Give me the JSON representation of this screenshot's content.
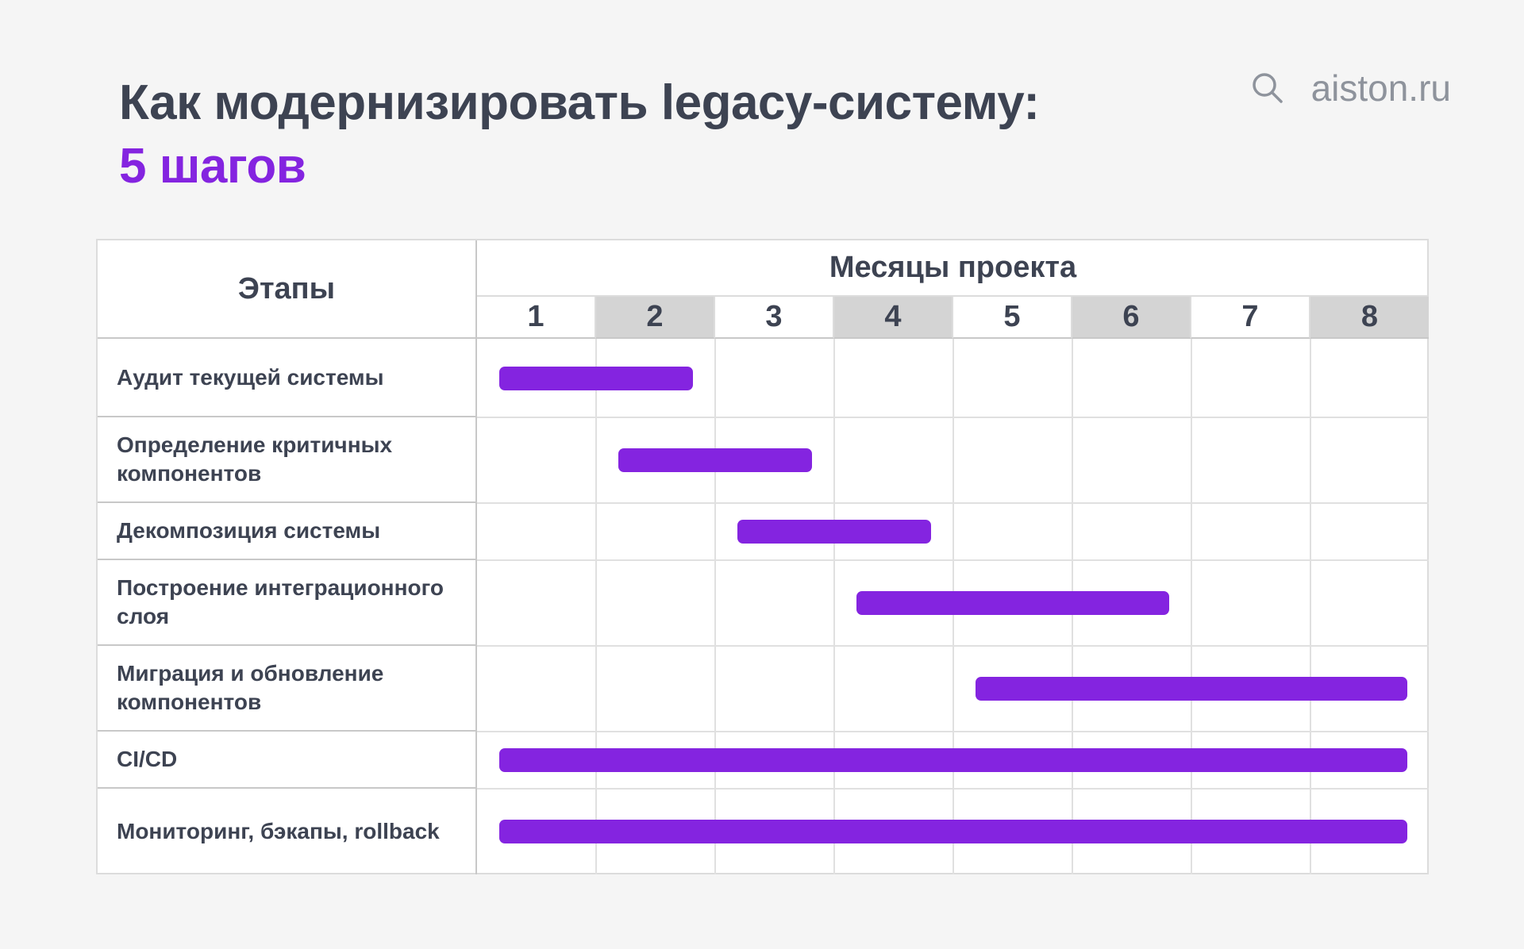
{
  "header": {
    "title_line1": "Как модернизировать legacy-систему:",
    "title_line2": "5 шагов",
    "brand": "aiston.ru",
    "brand_icon": "search-icon"
  },
  "colors": {
    "accent": "#8424e0",
    "text": "#3d4352",
    "shaded_month": "#d4d4d4",
    "brand_text": "#8e939c"
  },
  "chart_data": {
    "type": "gantt",
    "row_header": "Этапы",
    "column_group_header": "Месяцы проекта",
    "months": [
      "1",
      "2",
      "3",
      "4",
      "5",
      "6",
      "7",
      "8"
    ],
    "shaded_months": [
      "2",
      "4",
      "6",
      "8"
    ],
    "tasks": [
      {
        "label": "Аудит текущей системы",
        "start": 1,
        "end": 2
      },
      {
        "label": "Определение критичных компонентов",
        "start": 2,
        "end": 3
      },
      {
        "label": "Декомпозиция системы",
        "start": 3,
        "end": 4
      },
      {
        "label": "Построение интеграционного слоя",
        "start": 4,
        "end": 6
      },
      {
        "label": "Миграция и обновление компонентов",
        "start": 5,
        "end": 8
      },
      {
        "label": "CI/CD",
        "start": 1,
        "end": 8
      },
      {
        "label": "Мониторинг, бэкапы, rollback",
        "start": 1,
        "end": 8
      }
    ]
  }
}
